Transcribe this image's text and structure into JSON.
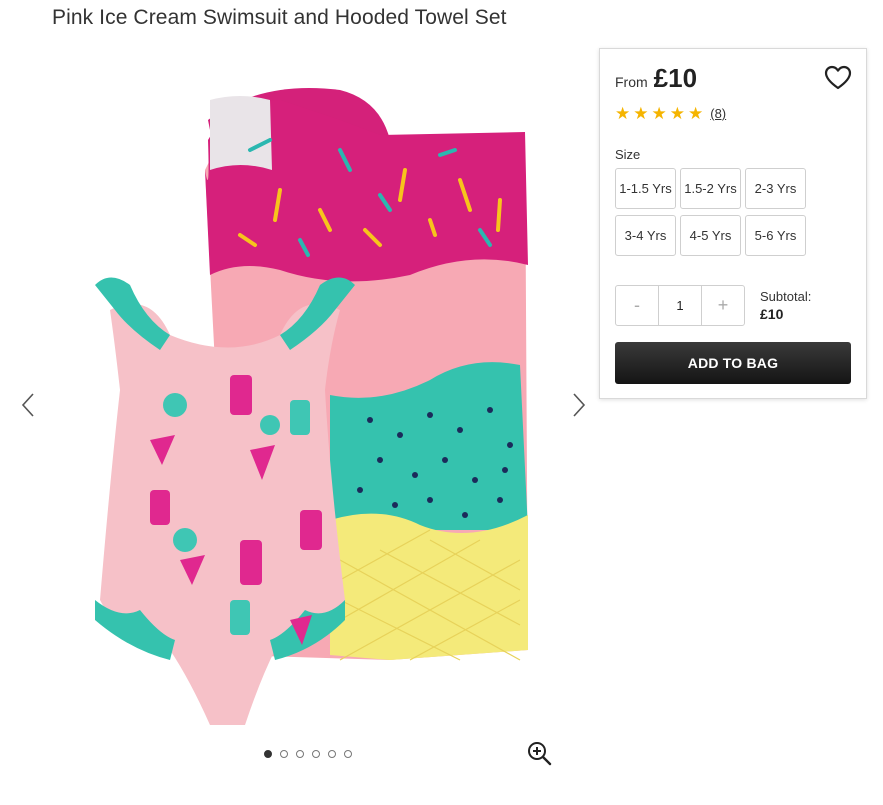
{
  "product": {
    "title": "Pink Ice Cream Swimsuit and Hooded Towel Set"
  },
  "gallery": {
    "dots": [
      {
        "active": true
      },
      {
        "active": false
      },
      {
        "active": false
      },
      {
        "active": false
      },
      {
        "active": false
      },
      {
        "active": false
      }
    ],
    "icons": {
      "prev": "chevron-left-icon",
      "next": "chevron-right-icon",
      "zoom": "zoom-in-icon"
    }
  },
  "buy_box": {
    "price_prefix": "From",
    "price": "£10",
    "rating": {
      "stars": 5,
      "max": 5,
      "count_label": "(8)"
    },
    "size_label": "Size",
    "sizes": [
      "1-1.5 Yrs",
      "1.5-2 Yrs",
      "2-3 Yrs",
      "3-4 Yrs",
      "4-5 Yrs",
      "5-6 Yrs"
    ],
    "quantity": {
      "minus": "-",
      "value": "1",
      "plus": "+"
    },
    "subtotal_label": "Subtotal:",
    "subtotal_value": "£10",
    "add_to_bag": "ADD TO BAG",
    "icons": {
      "wishlist": "heart-icon",
      "star": "star-icon"
    }
  },
  "colors": {
    "star": "#f5b400",
    "button": "#222222"
  }
}
